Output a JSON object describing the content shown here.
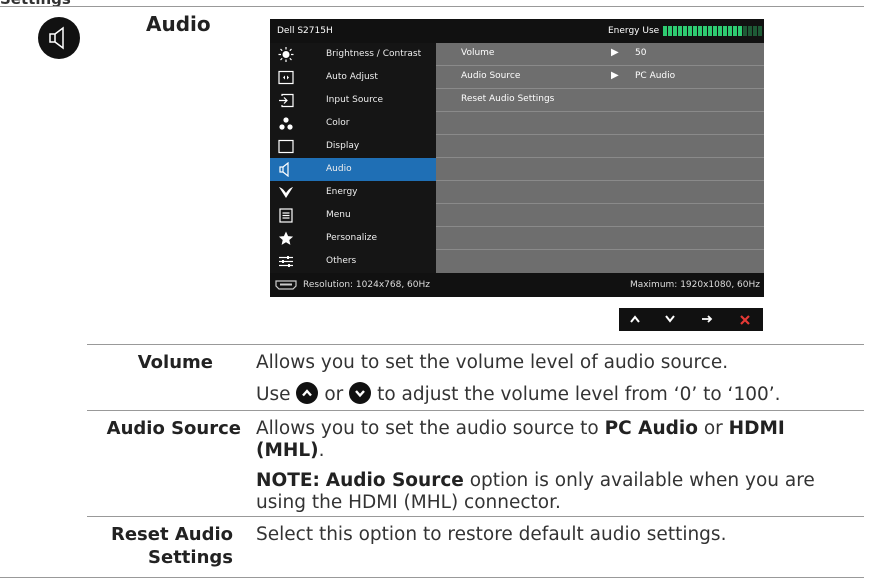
{
  "doc": {
    "clipped_title": "Settings",
    "section_title": "Audio"
  },
  "osd": {
    "model": "Dell S2715H",
    "energy_label": "Energy Use",
    "energy_level": 0.8,
    "menu": [
      {
        "label": "Brightness / Contrast",
        "icon": "brightness-icon"
      },
      {
        "label": "Auto Adjust",
        "icon": "auto-adjust-icon"
      },
      {
        "label": "Input Source",
        "icon": "input-source-icon"
      },
      {
        "label": "Color",
        "icon": "color-icon"
      },
      {
        "label": "Display",
        "icon": "display-icon"
      },
      {
        "label": "Audio",
        "icon": "audio-icon"
      },
      {
        "label": "Energy",
        "icon": "energy-icon"
      },
      {
        "label": "Menu",
        "icon": "menu-icon"
      },
      {
        "label": "Personalize",
        "icon": "star-icon"
      },
      {
        "label": "Others",
        "icon": "others-icon"
      }
    ],
    "active_menu": "Audio",
    "submenu": [
      {
        "label": "Volume",
        "value": "50"
      },
      {
        "label": "Audio Source",
        "value": "PC Audio"
      },
      {
        "label": "Reset Audio Settings",
        "value": ""
      }
    ],
    "footer_left": "Resolution: 1024x768, 60Hz",
    "footer_right": "Maximum: 1920x1080, 60Hz",
    "nav_icons": [
      "up-arrow-icon",
      "down-arrow-icon",
      "right-arrow-icon",
      "close-icon"
    ]
  },
  "table": {
    "volume": {
      "label": "Volume",
      "line1": "Allows you to set the volume level of audio source.",
      "use": "Use",
      "or": "or",
      "line2_rest": "to adjust the volume level from ‘0’ to ‘100’."
    },
    "audio_source": {
      "label": "Audio Source",
      "p1_a": "Allows you to set the audio source to",
      "p1_b": "PC Audio",
      "p1_c": "or",
      "p1_d": "HDMI (MHL)",
      "p1_e": ".",
      "note_a": "NOTE:",
      "note_b": "Audio Source",
      "note_c": "option is only available when you are using the HDMI (MHL) connector."
    },
    "reset": {
      "label_line1": "Reset Audio",
      "label_line2": "Settings",
      "desc": "Select this option to restore default audio settings."
    }
  }
}
